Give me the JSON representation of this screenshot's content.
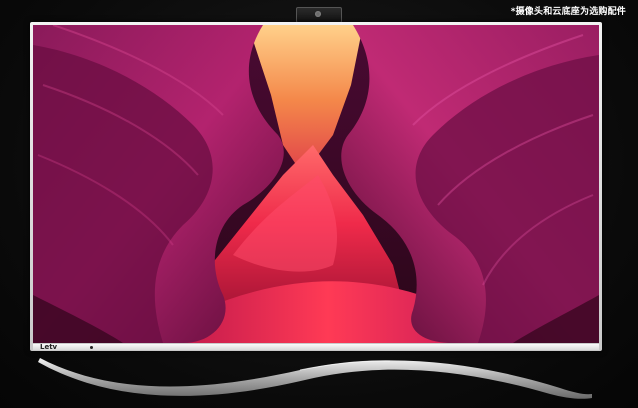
{
  "note": "*摄像头和云底座为选购配件",
  "logo_text": "Letv",
  "colors": {
    "background": "#0b0b0b",
    "bezel": "#e6e6e6",
    "wallpaper_primary": "#b0165a",
    "wallpaper_highlight": "#ff3a4a",
    "wallpaper_glow": "#f6a35a"
  },
  "icons": [
    "camera-icon",
    "power-led-icon"
  ]
}
